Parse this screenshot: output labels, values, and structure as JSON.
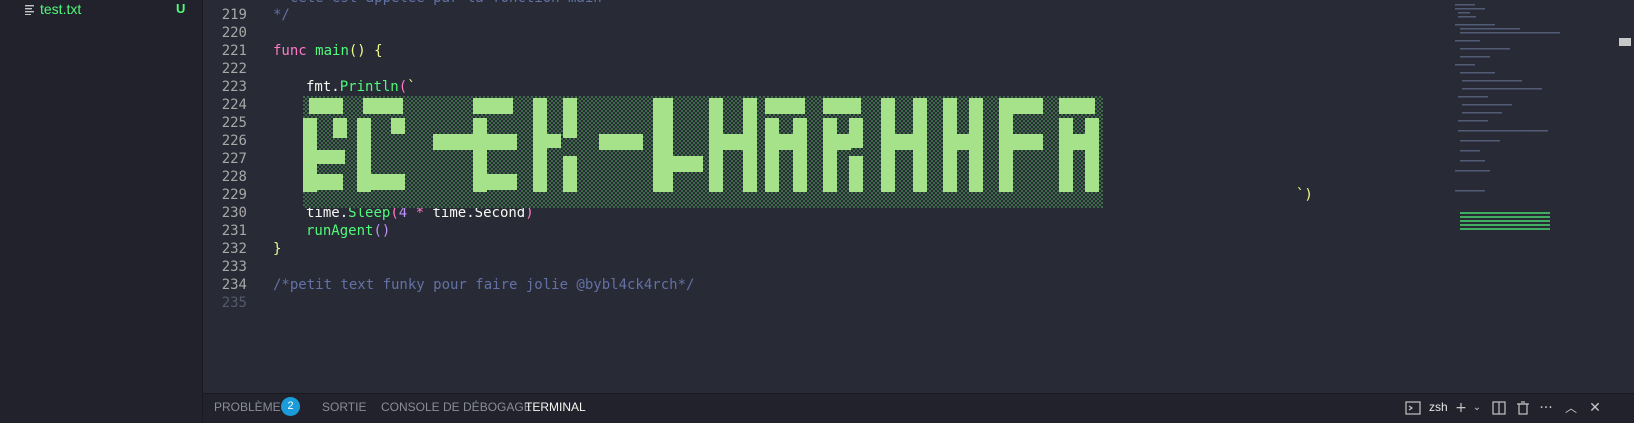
{
  "explorer": {
    "file_name": "test.txt",
    "file_status": "U"
  },
  "editor": {
    "lines": [
      {
        "num": "219",
        "text": "*/"
      },
      {
        "num": "220",
        "text": ""
      },
      {
        "num": "221",
        "kw": "func",
        "name": "main",
        "rest": "() {"
      },
      {
        "num": "222",
        "text": ""
      },
      {
        "num": "223",
        "obj": "fmt",
        "method": "Println",
        "open": "(`"
      },
      {
        "num": "224"
      },
      {
        "num": "225"
      },
      {
        "num": "226"
      },
      {
        "num": "227"
      },
      {
        "num": "228"
      },
      {
        "num": "229",
        "tail": "`)"
      },
      {
        "num": "230",
        "obj": "time",
        "method": "Sleep",
        "num_val": "4",
        "op": "*",
        "obj2": "time",
        "member": "Second"
      },
      {
        "num": "231",
        "name": "runAgent",
        "rest": "()"
      },
      {
        "num": "232",
        "text": "}"
      },
      {
        "num": "233",
        "text": ""
      },
      {
        "num": "234",
        "text": "/*petit text funky pour faire jolie @bybl4ck4rch*/"
      },
      {
        "num": "235",
        "text": ""
      }
    ],
    "accent_green": "#50fa7b"
  },
  "panel": {
    "tabs": [
      "PROBLÈMES",
      "SORTIE",
      "CONSOLE DE DÉBOGAGE",
      "TERMINAL"
    ],
    "problems_count": "2",
    "active_tab": "TERMINAL",
    "shell": "zsh",
    "icons": [
      "terminal-icon",
      "plus-icon",
      "chevron-down-icon",
      "split-icon",
      "trash-icon",
      "more-icon",
      "chevron-up-icon",
      "close-icon"
    ]
  }
}
